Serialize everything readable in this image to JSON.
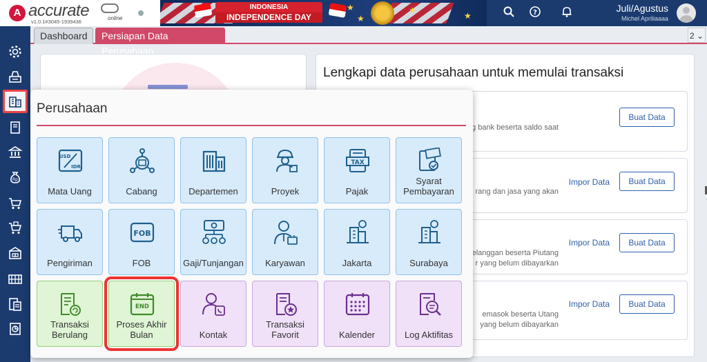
{
  "app": {
    "logo_letter": "A",
    "logo_text": "accurate",
    "logo_sub": "online",
    "version": "v1.0.1#3045-1939436"
  },
  "banner": {
    "line1": "INDONESIA",
    "line2": "INDEPENDENCE DAY"
  },
  "header": {
    "period": "Juli/Agustus",
    "user": "Michel Apriliaaaa",
    "icons": [
      "search-icon",
      "help-icon",
      "bell-icon"
    ]
  },
  "tabs": {
    "dashboard": "Dashboard",
    "active": "Persiapan Data Perusahaan",
    "count": "2 ⌄"
  },
  "sidebar": {
    "items": [
      "settings",
      "cash-register",
      "company",
      "book",
      "bank",
      "money-bag",
      "shopping-cart",
      "sales-cart",
      "warehouse",
      "inventory",
      "tax",
      "report"
    ]
  },
  "right_panel": {
    "heading": "Lengkapi data perusahaan untuk memulai transaksi",
    "cards": [
      {
        "desc": "g bank beserta saldo saat",
        "impor": "",
        "buat": "Buat Data"
      },
      {
        "desc": "rang dan jasa yang akan",
        "impor": "Impor Data",
        "buat": "Buat Data"
      },
      {
        "desc": "elanggan beserta Piutang\nr yang belum dibayarkan",
        "impor": "Impor Data",
        "buat": "Buat Data"
      },
      {
        "desc": "emasok beserta Utang\nyang belum dibayarkan",
        "impor": "Impor Data",
        "buat": "Buat Data"
      }
    ]
  },
  "popup": {
    "title": "Perusahaan",
    "tiles": [
      {
        "label": "Mata Uang",
        "icon": "currency-icon",
        "color": "blue"
      },
      {
        "label": "Cabang",
        "icon": "branch-icon",
        "color": "blue"
      },
      {
        "label": "Departemen",
        "icon": "department-icon",
        "color": "blue"
      },
      {
        "label": "Proyek",
        "icon": "project-icon",
        "color": "blue"
      },
      {
        "label": "Pajak",
        "icon": "tax-icon",
        "color": "blue"
      },
      {
        "label": "Syarat Pembayaran",
        "icon": "payment-terms-icon",
        "color": "blue"
      },
      {
        "label": "Pengiriman",
        "icon": "shipping-icon",
        "color": "blue"
      },
      {
        "label": "FOB",
        "icon": "fob-icon",
        "color": "blue"
      },
      {
        "label": "Gaji/Tunjangan",
        "icon": "salary-icon",
        "color": "blue"
      },
      {
        "label": "Karyawan",
        "icon": "employee-icon",
        "color": "blue"
      },
      {
        "label": "Jakarta",
        "icon": "city-icon",
        "color": "blue"
      },
      {
        "label": "Surabaya",
        "icon": "city-icon",
        "color": "blue"
      },
      {
        "label": "Transaksi Berulang",
        "icon": "recurring-icon",
        "color": "green"
      },
      {
        "label": "Proses Akhir Bulan",
        "icon": "month-end-icon",
        "color": "green"
      },
      {
        "label": "Kontak",
        "icon": "contact-icon",
        "color": "purple"
      },
      {
        "label": "Transaksi Favorit",
        "icon": "favorite-icon",
        "color": "purple"
      },
      {
        "label": "Kalender",
        "icon": "calendar-icon",
        "color": "purple"
      },
      {
        "label": "Log Aktifitas",
        "icon": "activity-log-icon",
        "color": "purple"
      }
    ],
    "text_usd": "USD",
    "text_idr": "IDR",
    "text_tax": "TAX",
    "text_fob": "FOB",
    "text_end": "END"
  }
}
